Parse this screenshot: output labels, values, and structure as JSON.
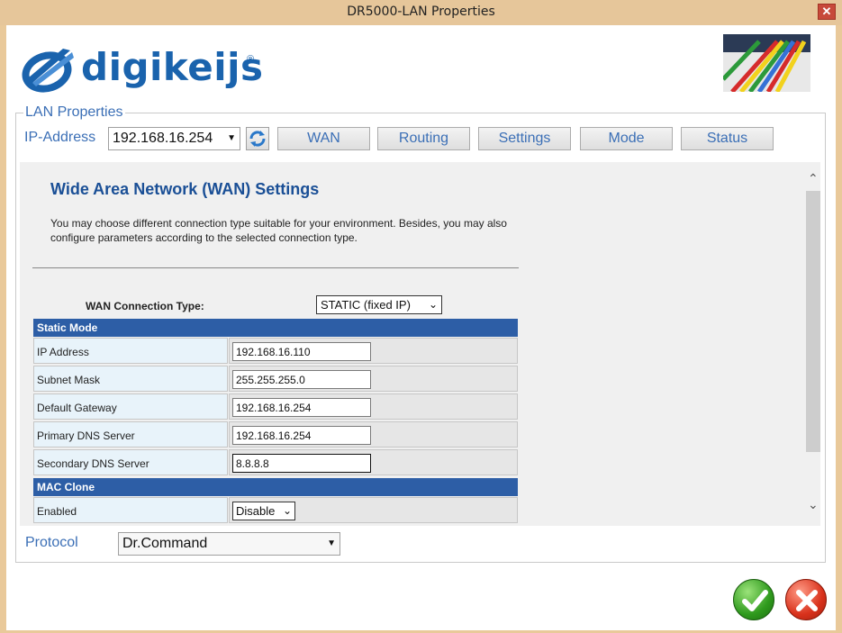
{
  "window": {
    "title": "DR5000-LAN Properties",
    "close_icon": "close-icon"
  },
  "brand": {
    "logo_text": "digikeijs",
    "registered": "®",
    "logo_icon": "digikeijs-logo-icon"
  },
  "lan": {
    "legend": "LAN Properties",
    "ip_label": "IP-Address",
    "ip_value": "192.168.16.254",
    "tabs": [
      {
        "label": "WAN"
      },
      {
        "label": "Routing"
      },
      {
        "label": "Settings"
      },
      {
        "label": "Mode"
      },
      {
        "label": "Status"
      }
    ]
  },
  "wan": {
    "title": "Wide Area Network (WAN) Settings",
    "description": "You may choose different connection type suitable for your environment. Besides, you may also configure parameters according to the selected connection type.",
    "conn_label": "WAN Connection Type:",
    "conn_value": "STATIC (fixed IP)",
    "static_section": "Static Mode",
    "fields": [
      {
        "label": "IP Address",
        "value": "192.168.16.110"
      },
      {
        "label": "Subnet Mask",
        "value": "255.255.255.0"
      },
      {
        "label": "Default Gateway",
        "value": "192.168.16.254"
      },
      {
        "label": "Primary DNS Server",
        "value": "192.168.16.254"
      },
      {
        "label": "Secondary DNS Server",
        "value": "8.8.8.8"
      }
    ],
    "mac_section": "MAC Clone",
    "enabled_label": "Enabled",
    "enabled_value": "Disable"
  },
  "protocol": {
    "label": "Protocol",
    "value": "Dr.Command"
  },
  "colors": {
    "accent": "#3b6fb6",
    "section_bar": "#2d5ea6",
    "title_blue": "#1a4f96",
    "ok": "#2f9a1d",
    "cancel": "#d9321c"
  }
}
